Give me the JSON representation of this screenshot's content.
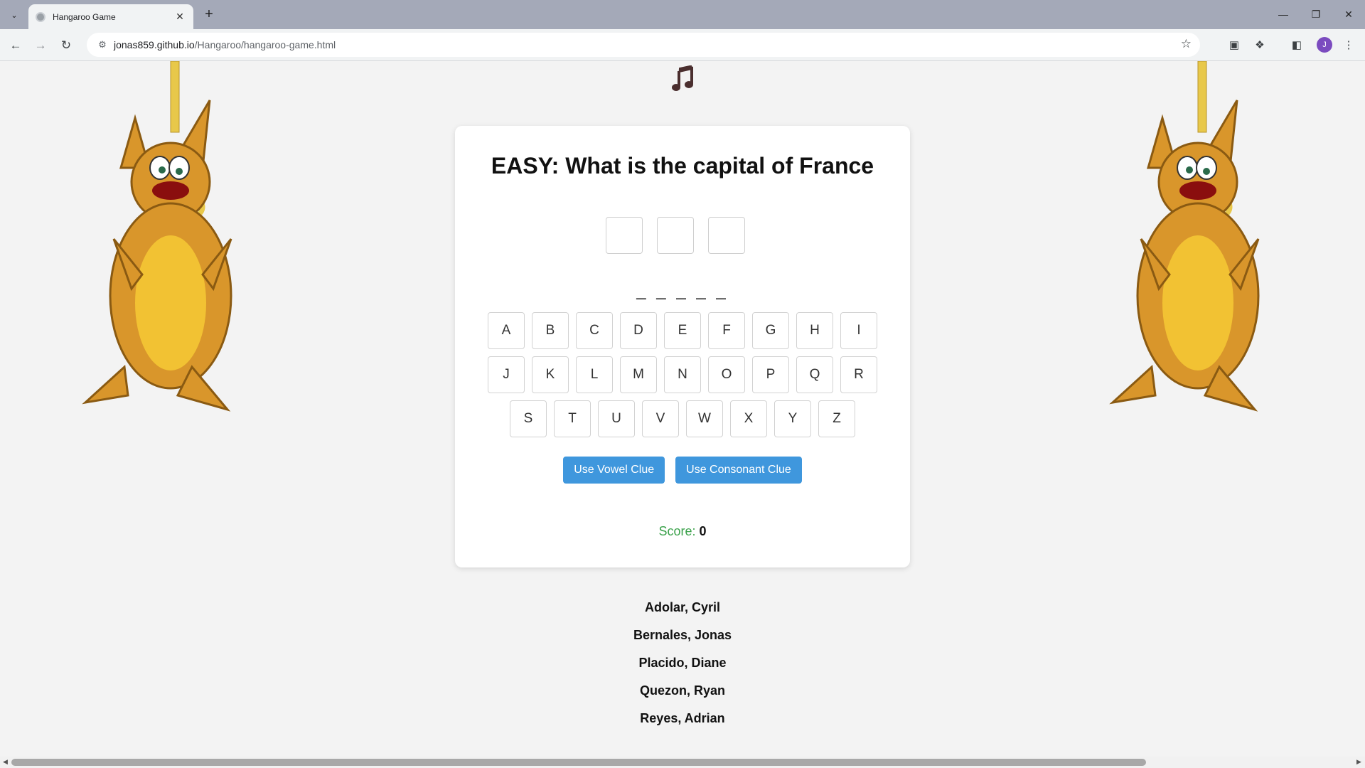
{
  "browser": {
    "tab_title": "Hangaroo Game",
    "url_domain": "jonas859.github.io",
    "url_path": "/Hangaroo/hangaroo-game.html",
    "profile_initial": "J"
  },
  "game": {
    "question": "EASY: What is the capital of France",
    "blanks": "_ _ _ _ _",
    "keyboard_rows": [
      [
        "A",
        "B",
        "C",
        "D",
        "E",
        "F",
        "G",
        "H",
        "I"
      ],
      [
        "J",
        "K",
        "L",
        "M",
        "N",
        "O",
        "P",
        "Q",
        "R"
      ],
      [
        "S",
        "T",
        "U",
        "V",
        "W",
        "X",
        "Y",
        "Z"
      ]
    ],
    "vowel_clue_label": "Use Vowel Clue",
    "consonant_clue_label": "Use Consonant Clue",
    "score_label": "Score:",
    "score_value": "0"
  },
  "team": [
    "Adolar, Cyril",
    "Bernales, Jonas",
    "Placido, Diane",
    "Quezon, Ryan",
    "Reyes, Adrian"
  ],
  "colors": {
    "button_blue": "#3f97dd",
    "score_green": "#3aa14a",
    "kangaroo_body": "#d9962b",
    "kangaroo_belly": "#f2c233"
  }
}
